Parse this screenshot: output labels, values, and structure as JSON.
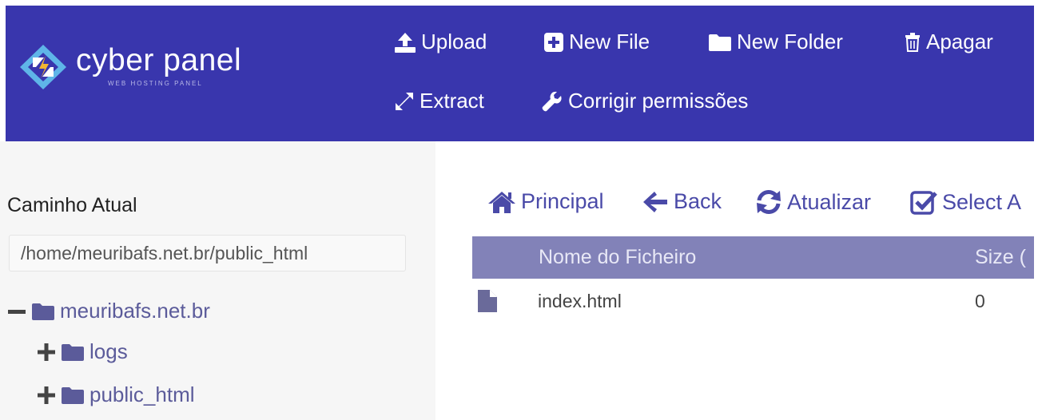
{
  "brand": {
    "name": "cyber panel",
    "tagline": "WEB HOSTING PANEL"
  },
  "header_actions": {
    "upload": "Upload",
    "new_file": "New File",
    "new_folder": "New Folder",
    "delete": "Apagar",
    "extract": "Extract",
    "fix_permissions": "Corrigir permissões"
  },
  "sidebar": {
    "path_label": "Caminho Atual",
    "path_value": "/home/meuribafs.net.br/public_html",
    "tree": {
      "root": {
        "label": "meuribafs.net.br",
        "toggle": "minus"
      },
      "children": [
        {
          "label": "logs",
          "toggle": "plus"
        },
        {
          "label": "public_html",
          "toggle": "plus"
        }
      ]
    }
  },
  "toolbar": {
    "home": "Principal",
    "back": "Back",
    "refresh": "Atualizar",
    "select_all": "Select A"
  },
  "table": {
    "headers": {
      "name": "Nome do Ficheiro",
      "size": "Size ("
    },
    "rows": [
      {
        "icon": "file-icon",
        "name": "index.html",
        "size": "0"
      }
    ]
  },
  "colors": {
    "header_bg": "#3936ad",
    "table_header_bg": "#8282b8",
    "link": "#4a4aa8",
    "sidebar_bg": "#f6f6f6"
  }
}
